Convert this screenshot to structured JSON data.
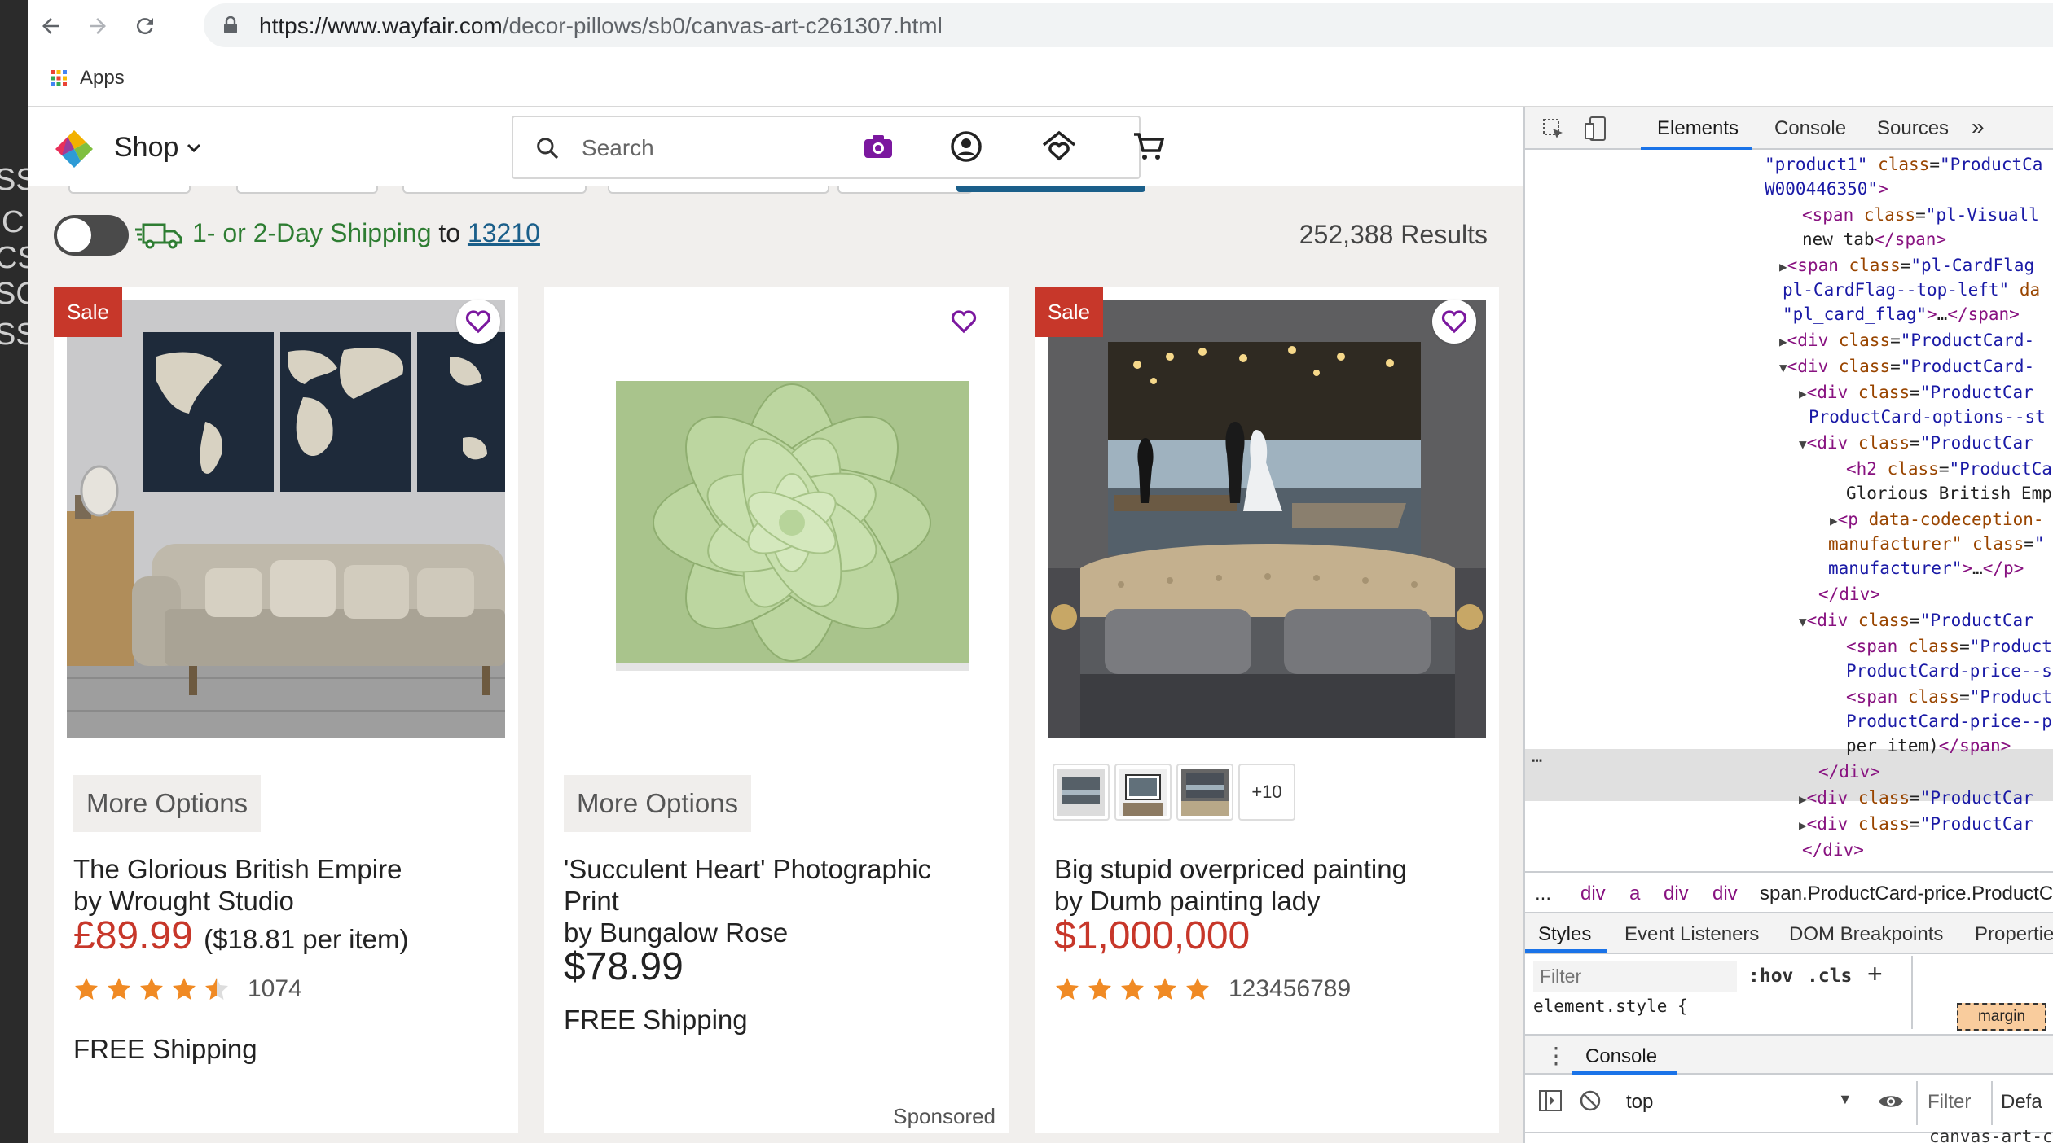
{
  "browser": {
    "url_host": "https://www.wayfair.com",
    "url_path": "/decor-pillows/sb0/canvas-art-c261307.html",
    "bookmarks_apps_label": "Apps"
  },
  "left_strip_fragments": [
    "SS",
    "C",
    "CSS",
    "SC",
    "SS"
  ],
  "header": {
    "shop_label": "Shop",
    "search_placeholder": "Search"
  },
  "shipping": {
    "text": "1- or 2-Day Shipping",
    "to": "to",
    "zip": "13210",
    "results": "252,388 Results"
  },
  "products": [
    {
      "badge": "Sale",
      "more_options": "More Options",
      "title": "The Glorious British Empire",
      "by": "by Wrought Studio",
      "price": "£89.99",
      "per_item": "($18.81 per item)",
      "rating_stars": 4.5,
      "rating_count": "1074",
      "shipping": "FREE Shipping",
      "on_sale": true
    },
    {
      "badge": "",
      "more_options": "More Options",
      "title": "'Succulent Heart' Photographic Print",
      "by": "by Bungalow Rose",
      "price": "$78.99",
      "shipping": "FREE Shipping",
      "sponsored": "Sponsored",
      "on_sale": false
    },
    {
      "badge": "Sale",
      "title": "Big stupid overpriced painting",
      "by": "by Dumb painting lady",
      "price": "$1,000,000",
      "rating_stars": 5,
      "rating_count": "123456789",
      "thumb_more": "+10",
      "on_sale": true
    }
  ],
  "devtools": {
    "tabs": {
      "elements": "Elements",
      "console": "Console",
      "sources": "Sources",
      "more": "»"
    },
    "breadcrumbs": [
      "...",
      "div",
      "a",
      "div",
      "div",
      "span.ProductCard-price.ProductC"
    ],
    "subtabs": {
      "styles": "Styles",
      "listeners": "Event Listeners",
      "dom_bp": "DOM Breakpoints",
      "properties": "Propertie"
    },
    "filter_placeholder": "Filter",
    "hov": ":hov",
    "cls": ".cls",
    "plus": "+",
    "element_style": "element.style {",
    "box_margin": "margin",
    "console_drawer": "Console",
    "console_context": "top",
    "console_filter": "Filter",
    "console_levels": "Defa",
    "bottom_fragment": "canvas-art-c"
  },
  "colors": {
    "sale_red": "#c7372a",
    "shipping_green": "#2e7d32",
    "link_blue": "#1b5f8a",
    "heart_purple": "#7b189f",
    "star_orange": "#f08a24",
    "devtools_blue": "#1a73e8"
  }
}
